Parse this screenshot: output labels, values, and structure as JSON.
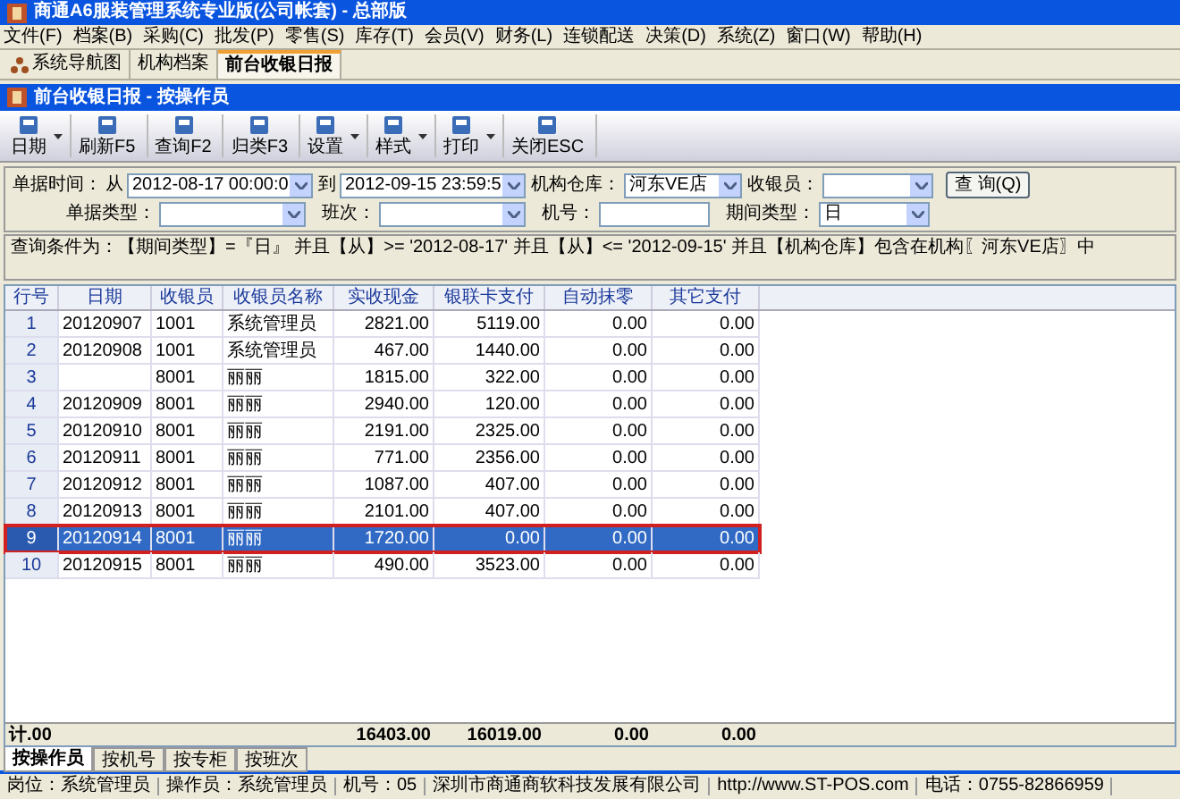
{
  "window": {
    "title": "商通A6服装管理系统专业版(公司帐套) - 总部版"
  },
  "menu": [
    "文件(F)",
    "档案(B)",
    "采购(C)",
    "批发(P)",
    "零售(S)",
    "库存(T)",
    "会员(V)",
    "财务(L)",
    "连锁配送",
    "决策(D)",
    "系统(Z)",
    "窗口(W)",
    "帮助(H)"
  ],
  "doc_tabs": [
    {
      "label": "系统导航图",
      "selected": false,
      "icon": true
    },
    {
      "label": "机构档案",
      "selected": false,
      "icon": false
    },
    {
      "label": "前台收银日报",
      "selected": true,
      "icon": false
    }
  ],
  "subwindow": {
    "title": "前台收银日报 - 按操作员"
  },
  "toolbar": [
    {
      "label": "日期",
      "dropdown": true
    },
    {
      "label": "刷新F5",
      "dropdown": false
    },
    {
      "label": "查询F2",
      "dropdown": false
    },
    {
      "label": "归类F3",
      "dropdown": false
    },
    {
      "label": "设置",
      "dropdown": true
    },
    {
      "label": "样式",
      "dropdown": true
    },
    {
      "label": "打印",
      "dropdown": true
    },
    {
      "label": "关闭ESC",
      "dropdown": false
    }
  ],
  "filters": {
    "row1": [
      {
        "label": "单据时间：",
        "prefix": "从",
        "value": "2012-08-17 00:00:0",
        "kind": "combo"
      },
      {
        "label": "到",
        "value": "2012-09-15 23:59:5",
        "kind": "combo"
      },
      {
        "label": "机构仓库：",
        "value": "河东VE店",
        "kind": "combo"
      },
      {
        "label": "收银员：",
        "kind": "combo"
      }
    ],
    "query_button": "查 询(Q)",
    "row2": [
      {
        "label": "单据类型：",
        "kind": "combo"
      },
      {
        "label": "班次：",
        "kind": "combo"
      },
      {
        "label": "机号：",
        "kind": "text"
      },
      {
        "label": "期间类型：",
        "value": "日",
        "kind": "combo"
      }
    ]
  },
  "condition": "查询条件为：【期间类型】=『日』 并且【从】>= '2012-08-17' 并且【从】<= '2012-09-15' 并且【机构仓库】包含在机构〖河东VE店〗中",
  "table": {
    "columns": [
      "行号",
      "日期",
      "收银员",
      "收银员名称",
      "实收现金",
      "银联卡支付",
      "自动抹零",
      "其它支付"
    ],
    "rows": [
      {
        "cells": [
          "1",
          "20120907",
          "1001",
          "系统管理员",
          "2821.00",
          "5119.00",
          "0.00",
          "0.00"
        ],
        "selected": false
      },
      {
        "cells": [
          "2",
          "20120908",
          "1001",
          "系统管理员",
          "467.00",
          "1440.00",
          "0.00",
          "0.00"
        ],
        "selected": false
      },
      {
        "cells": [
          "3",
          "",
          "8001",
          "丽丽",
          "1815.00",
          "322.00",
          "0.00",
          "0.00"
        ],
        "selected": false
      },
      {
        "cells": [
          "4",
          "20120909",
          "8001",
          "丽丽",
          "2940.00",
          "120.00",
          "0.00",
          "0.00"
        ],
        "selected": false
      },
      {
        "cells": [
          "5",
          "20120910",
          "8001",
          "丽丽",
          "2191.00",
          "2325.00",
          "0.00",
          "0.00"
        ],
        "selected": false
      },
      {
        "cells": [
          "6",
          "20120911",
          "8001",
          "丽丽",
          "771.00",
          "2356.00",
          "0.00",
          "0.00"
        ],
        "selected": false
      },
      {
        "cells": [
          "7",
          "20120912",
          "8001",
          "丽丽",
          "1087.00",
          "407.00",
          "0.00",
          "0.00"
        ],
        "selected": false
      },
      {
        "cells": [
          "8",
          "20120913",
          "8001",
          "丽丽",
          "2101.00",
          "407.00",
          "0.00",
          "0.00"
        ],
        "selected": false
      },
      {
        "cells": [
          "9",
          "20120914",
          "8001",
          "丽丽",
          "1720.00",
          "0.00",
          "0.00",
          "0.00"
        ],
        "selected": true
      },
      {
        "cells": [
          "10",
          "20120915",
          "8001",
          "丽丽",
          "490.00",
          "3523.00",
          "0.00",
          "0.00"
        ],
        "selected": false
      }
    ],
    "totals": [
      "计.00",
      "16403.00",
      "16019.00",
      "0.00",
      "0.00"
    ]
  },
  "bottom_tabs": [
    {
      "label": "按操作员",
      "selected": true
    },
    {
      "label": "按机号",
      "selected": false
    },
    {
      "label": "按专柜",
      "selected": false
    },
    {
      "label": "按班次",
      "selected": false
    }
  ],
  "status_bar": [
    "岗位：系统管理员",
    "操作员：系统管理员",
    "机号：05",
    "深圳市商通商软科技发展有限公司",
    "http://www.ST-POS.com",
    "电话：0755-82866959"
  ]
}
